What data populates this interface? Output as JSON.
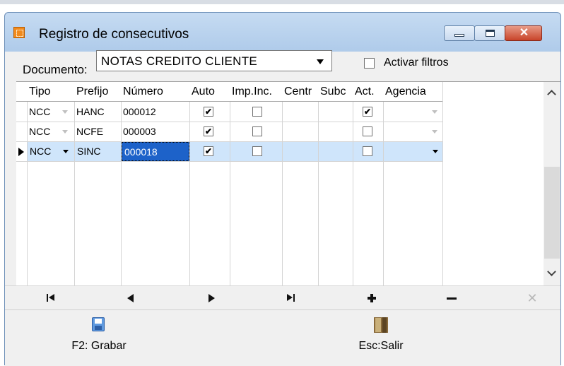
{
  "window": {
    "title": "Registro de consecutivos",
    "controls": {
      "minimize_icon": "minimize-icon",
      "maximize_icon": "maximize-icon",
      "close_label": "✕"
    }
  },
  "filters": {
    "document_label": "Documento:",
    "document_value": "NOTAS CREDITO CLIENTE",
    "activate_filters_label": "Activar filtros",
    "activate_filters_checked": false
  },
  "grid": {
    "columns": [
      "Tipo",
      "Prefijo",
      "Número",
      "Auto",
      "Imp.Inc.",
      "Centr",
      "Subc",
      "Act.",
      "Agencia"
    ],
    "rows": [
      {
        "tipo": "NCC",
        "prefijo": "HANC",
        "numero": "000012",
        "auto": "✔",
        "imp_inc": "",
        "act": "✔",
        "agencia": ""
      },
      {
        "tipo": "NCC",
        "prefijo": "NCFE",
        "numero": "000003",
        "auto": "✔",
        "imp_inc": "",
        "act": "",
        "agencia": ""
      },
      {
        "tipo": "NCC",
        "prefijo": "SINC",
        "numero": "000018",
        "auto": "✔",
        "imp_inc": "",
        "act": "",
        "agencia": ""
      }
    ],
    "current_row": 3
  },
  "navigator": {
    "icons": [
      "first-record-icon",
      "prior-record-icon",
      "next-record-icon",
      "last-record-icon",
      "add-record-icon",
      "delete-record-icon",
      "cancel-edit-icon"
    ],
    "cancel_glyph": "✕"
  },
  "toolbar": {
    "save_label": "F2: Grabar",
    "exit_label": "Esc:Salir"
  },
  "colors": {
    "title_gradient": "#bad3ee",
    "selection": "#cfe5fb",
    "edit_cell": "#1d62c9",
    "close_button": "#c8442a"
  }
}
